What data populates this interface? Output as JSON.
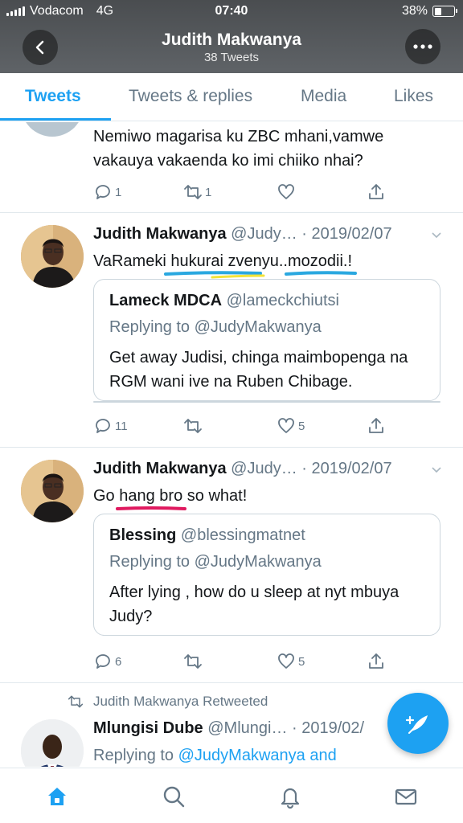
{
  "status_bar": {
    "carrier": "Vodacom",
    "network": "4G",
    "time": "07:40",
    "battery": "38%",
    "battery_level": 0.38
  },
  "header": {
    "title": "Judith Makwanya",
    "subtitle": "38 Tweets",
    "back_icon": "chevron-left-icon",
    "more_icon": "more-dots-icon"
  },
  "tabs": [
    {
      "label": "Tweets",
      "active": true
    },
    {
      "label": "Tweets & replies",
      "active": false
    },
    {
      "label": "Media",
      "active": false
    },
    {
      "label": "Likes",
      "active": false
    }
  ],
  "tweets": [
    {
      "text": "Nemiwo magarisa ku ZBC mhani,vamwe vakauya vakaenda ko imi chiiko nhai?",
      "replies": "1",
      "retweets": "1",
      "likes": "",
      "share": ""
    },
    {
      "name": "Judith Makwanya",
      "handle": "@Judy… · 2019/02/07",
      "text_plain": "VaRameki ",
      "text_u1": "hukurai zvenyu",
      "text_mid": "..",
      "text_u2": "mozodii",
      "text_end": ".!",
      "quote": {
        "name": "Lameck MDCA",
        "handle": "@lameckchiutsi",
        "reply": "Replying to @JudyMakwanya",
        "text": "Get away Judisi, chinga maimbopenga na RGM wani ive na Ruben Chibage."
      },
      "replies": "11",
      "retweets": "",
      "likes": "5"
    },
    {
      "name": "Judith Makwanya",
      "handle": "@Judy… · 2019/02/07",
      "text_pre": "Go ",
      "text_u": "hang bro",
      "text_post": " so what!",
      "quote": {
        "name": "Blessing",
        "handle": "@blessingmatnet",
        "reply": "Replying to @JudyMakwanya",
        "text": "After lying , how do u sleep at nyt mbuya Judy?"
      },
      "replies": "6",
      "retweets": "",
      "likes": "5"
    },
    {
      "retweeted_label": "Judith Makwanya Retweeted",
      "name": "Mlungisi  Dube",
      "handle": "@Mlungi… · 2019/02/",
      "reply_prefix": "Replying to ",
      "reply_link": "@JudyMakwanya and"
    }
  ],
  "colors": {
    "accent": "#1da1f2",
    "underline_blue": "#2aa8e0",
    "underline_yellow": "#f2e33a",
    "underline_pink": "#e0195f"
  },
  "bottom_nav": [
    "home-icon",
    "search-icon",
    "bell-icon",
    "mail-icon"
  ]
}
